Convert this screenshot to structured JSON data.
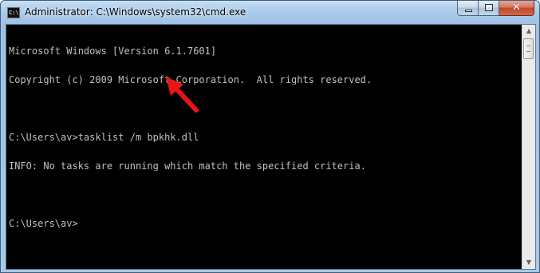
{
  "window": {
    "title": "Administrator: C:\\Windows\\system32\\cmd.exe",
    "app_icon_text": "C:\\"
  },
  "caption_buttons": {
    "minimize_icon": "minimize-icon",
    "maximize_icon": "maximize-icon",
    "close_glyph": "✕"
  },
  "console": {
    "lines": [
      "Microsoft Windows [Version 6.1.7601]",
      "Copyright (c) 2009 Microsoft Corporation.  All rights reserved.",
      "",
      "C:\\Users\\av>tasklist /m bpkhk.dll",
      "INFO: No tasks are running which match the specified criteria.",
      "",
      "C:\\Users\\av>"
    ],
    "background": "#000000",
    "foreground": "#c0c0c0"
  },
  "scrollbar": {
    "up_glyph": "▲",
    "down_glyph": "▼"
  },
  "annotation": {
    "arrow_color": "#e8141a"
  }
}
